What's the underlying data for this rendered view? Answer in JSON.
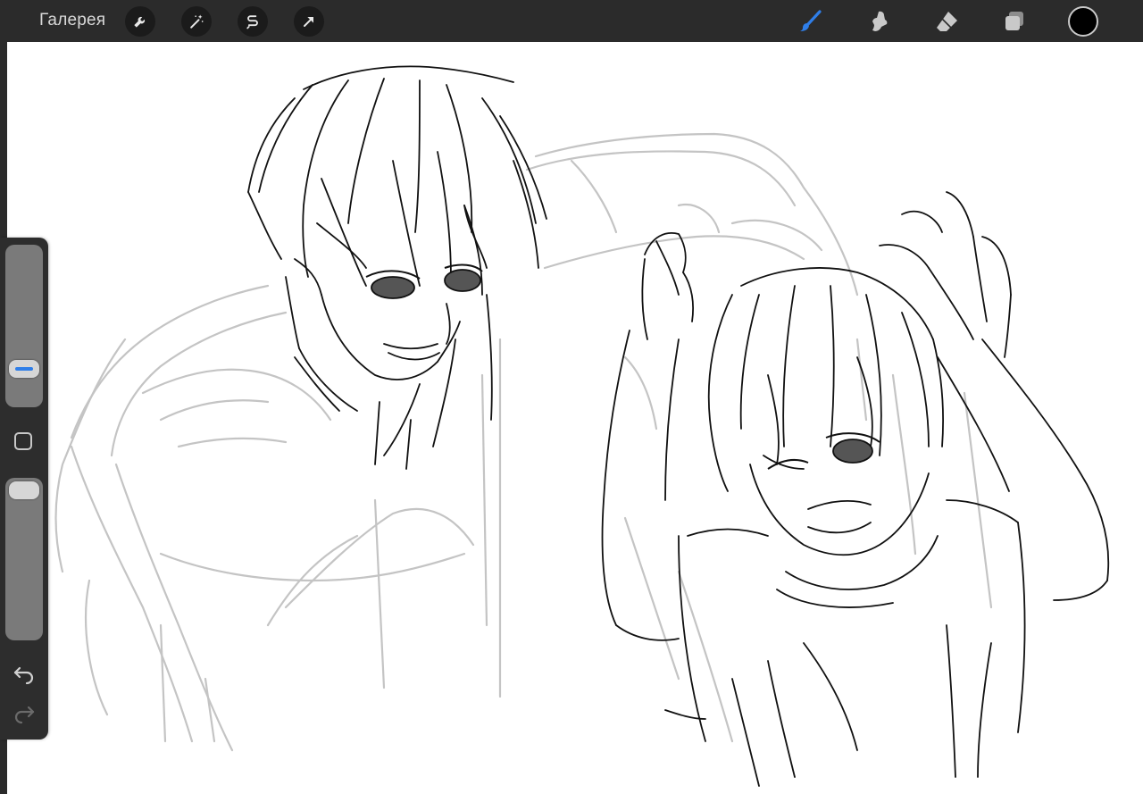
{
  "toolbar": {
    "gallery_label": "Галерея",
    "left_icons": [
      "wrench-icon",
      "magic-wand-icon",
      "selection-s-icon",
      "transform-arrow-icon"
    ],
    "right_icons": [
      "brush-icon",
      "smudge-icon",
      "eraser-icon",
      "layers-icon"
    ],
    "active_tool": "brush-icon",
    "active_color": "#000000",
    "accent_color": "#2f7ee8"
  },
  "sidebar": {
    "brush_size_level": 0.19,
    "brush_opacity_level": 1.0,
    "icons": [
      "modify-square-icon",
      "undo-icon",
      "redo-icon"
    ]
  },
  "canvas": {
    "background": "#ffffff",
    "content": "sketch-drawing"
  }
}
